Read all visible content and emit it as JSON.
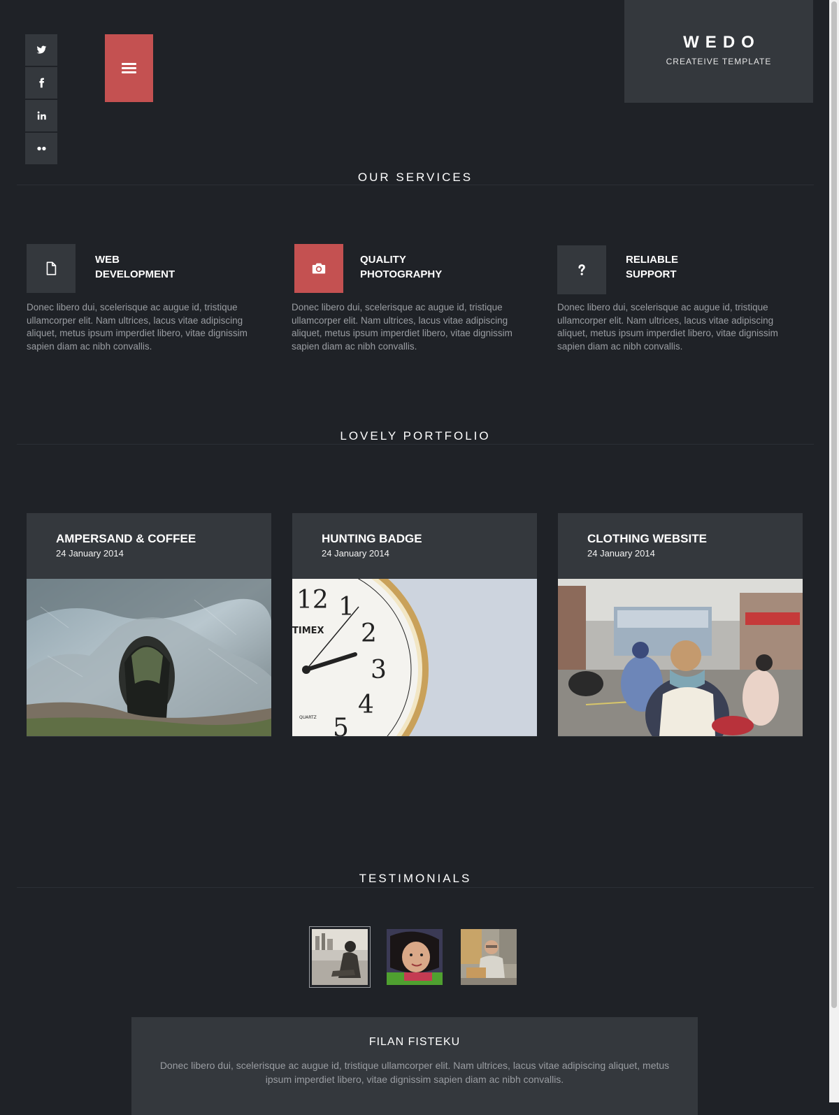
{
  "brand": {
    "title": "WEDO",
    "subtitle": "CREATEIVE TEMPLATE"
  },
  "social": {
    "items": [
      {
        "icon": "twitter-icon"
      },
      {
        "icon": "facebook-icon"
      },
      {
        "icon": "linkedin-icon"
      },
      {
        "icon": "flickr-icon"
      }
    ]
  },
  "menu": {
    "icon": "hamburger-menu-icon"
  },
  "services": {
    "title": "OUR SERVICES",
    "items": [
      {
        "icon": "file-icon",
        "title_line1": "WEB",
        "title_line2": "DEVELOPMENT",
        "desc": "Donec libero dui, scelerisque ac augue id, tristique ullamcorper elit. Nam ultrices, lacus vitae adipiscing aliquet, metus ipsum imperdiet libero, vitae dignissim sapien diam ac nibh convallis."
      },
      {
        "icon": "camera-icon",
        "title_line1": "QUALITY",
        "title_line2": "PHOTOGRAPHY",
        "desc": "Donec libero dui, scelerisque ac augue id, tristique ullamcorper elit. Nam ultrices, lacus vitae adipiscing aliquet, metus ipsum imperdiet libero, vitae dignissim sapien diam ac nibh convallis."
      },
      {
        "icon": "question-icon",
        "title_line1": "RELIABLE",
        "title_line2": "SUPPORT",
        "desc": "Donec libero dui, scelerisque ac augue id, tristique ullamcorper elit. Nam ultrices, lacus vitae adipiscing aliquet, metus ipsum imperdiet libero, vitae dignissim sapien diam ac nibh convallis."
      }
    ]
  },
  "portfolio": {
    "title": "LOVELY PORTFOLIO",
    "items": [
      {
        "title": "AMPERSAND & COFFEE",
        "date": "24 January 2014"
      },
      {
        "title": "HUNTING BADGE",
        "date": "24 January 2014"
      },
      {
        "title": "CLOTHING WEBSITE",
        "date": "24 January 2014"
      }
    ]
  },
  "testimonials": {
    "title": "TESTIMONIALS",
    "active": {
      "name": "FILAN FISTEKU",
      "text": "Donec libero dui, scelerisque ac augue id, tristique ullamcorper elit. Nam ultrices, lacus vitae adipiscing aliquet, metus ipsum imperdiet libero, vitae dignissim sapien diam ac nibh convallis."
    }
  },
  "colors": {
    "background": "#1f2227",
    "panel": "#34383d",
    "accent": "#c45151",
    "muted_text": "#9a9da2"
  }
}
